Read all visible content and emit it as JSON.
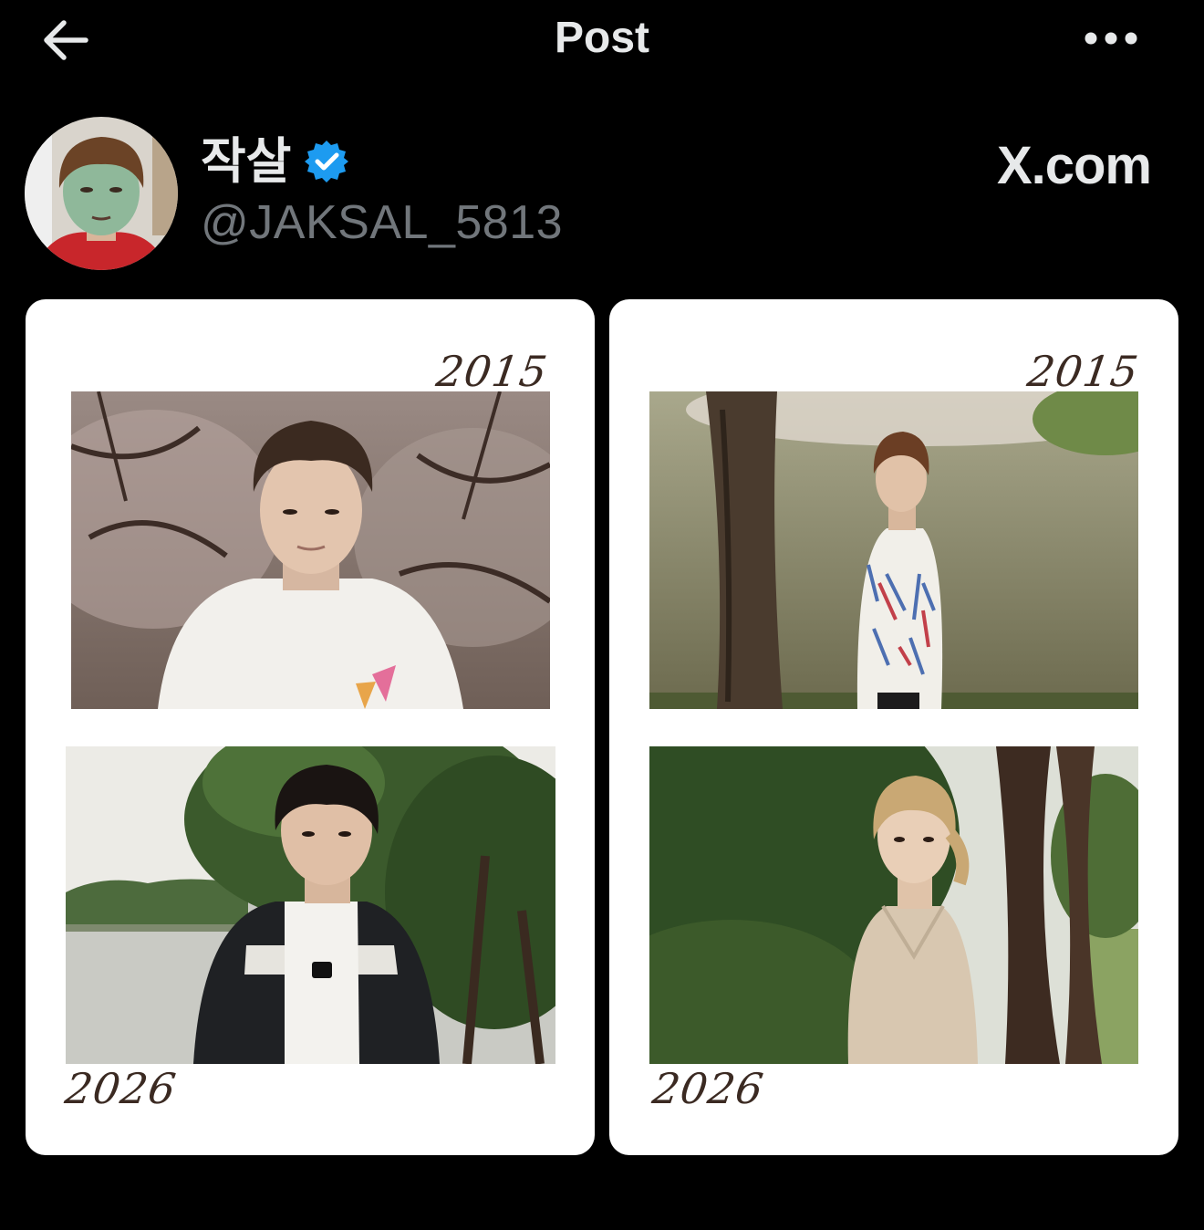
{
  "header": {
    "title": "Post",
    "back_icon": "arrow-left-icon",
    "more_icon": "more-horizontal-icon"
  },
  "author": {
    "display_name": "작살",
    "handle": "@JAKSAL_5813",
    "verified": true,
    "verified_color": "#1d9bf0"
  },
  "source": {
    "label": "X.com"
  },
  "cards": [
    {
      "top_year": "2015",
      "bottom_year": "2026"
    },
    {
      "top_year": "2015",
      "bottom_year": "2026"
    }
  ],
  "colors": {
    "background": "#000000",
    "text_primary": "#e7e9ea",
    "text_secondary": "#71767b",
    "card": "#ffffff",
    "year_text": "#3b2a22"
  }
}
